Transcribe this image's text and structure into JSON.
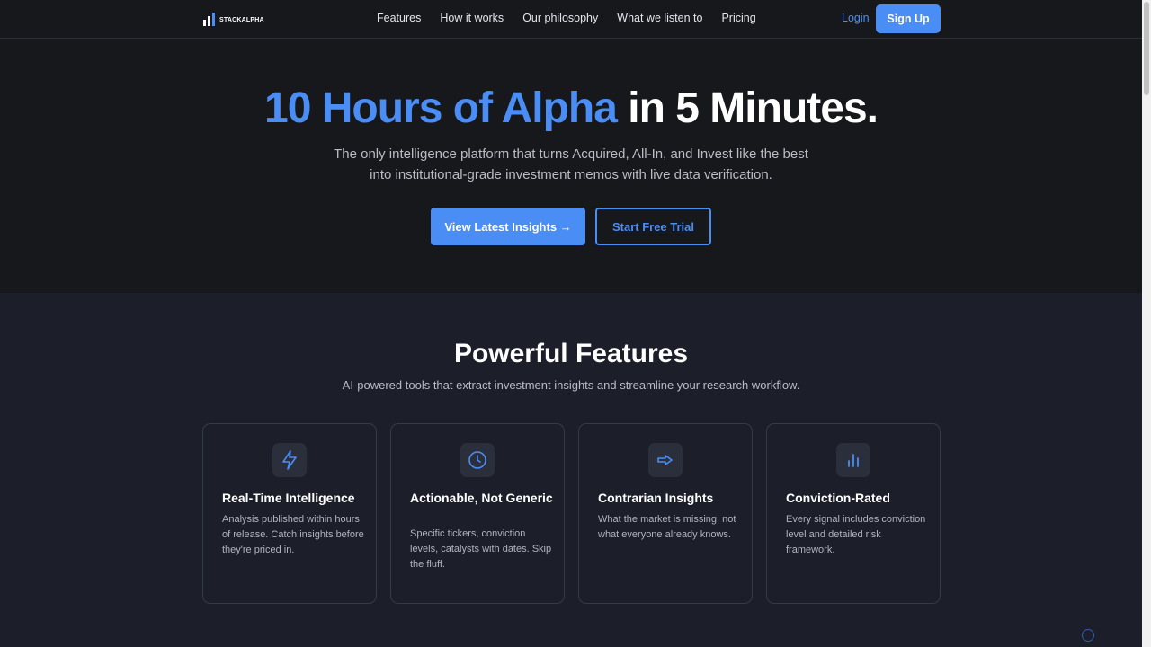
{
  "nav": {
    "logo_text": "STACKALPHA",
    "links": [
      "Features",
      "How it works",
      "Our philosophy",
      "What we listen to",
      "Pricing"
    ],
    "login": "Login",
    "signup": "Sign Up"
  },
  "hero": {
    "title_accent": "10 Hours of Alpha",
    "title_rest": "in 5 Minutes.",
    "subtitle": "The only intelligence platform that turns Acquired, All-In, and Invest like the best into institutional-grade investment memos with live data verification.",
    "primary_cta": "View Latest Insights →",
    "secondary_cta": "Start Free Trial"
  },
  "features": {
    "title": "Powerful Features",
    "subtitle": "AI-powered tools that extract investment insights and streamline your research workflow.",
    "cards": [
      {
        "icon": "lightning-icon",
        "title": "Real-Time Intelligence",
        "desc": "Analysis published within hours of release. Catch insights before they're priced in."
      },
      {
        "icon": "clock-icon",
        "title": "Actionable, Not Generic",
        "desc": "Specific tickers, conviction levels, catalysts with dates. Skip the fluff."
      },
      {
        "icon": "arrow-right-icon",
        "title": "Contrarian Insights",
        "desc": "What the market is missing, not what everyone already knows."
      },
      {
        "icon": "bar-chart-icon",
        "title": "Conviction-Rated",
        "desc": "Every signal includes conviction level and detailed risk framework."
      }
    ]
  },
  "colors": {
    "accent": "#4a8df5",
    "hero_bg": "#17181c",
    "features_bg": "#1c1f2a"
  }
}
